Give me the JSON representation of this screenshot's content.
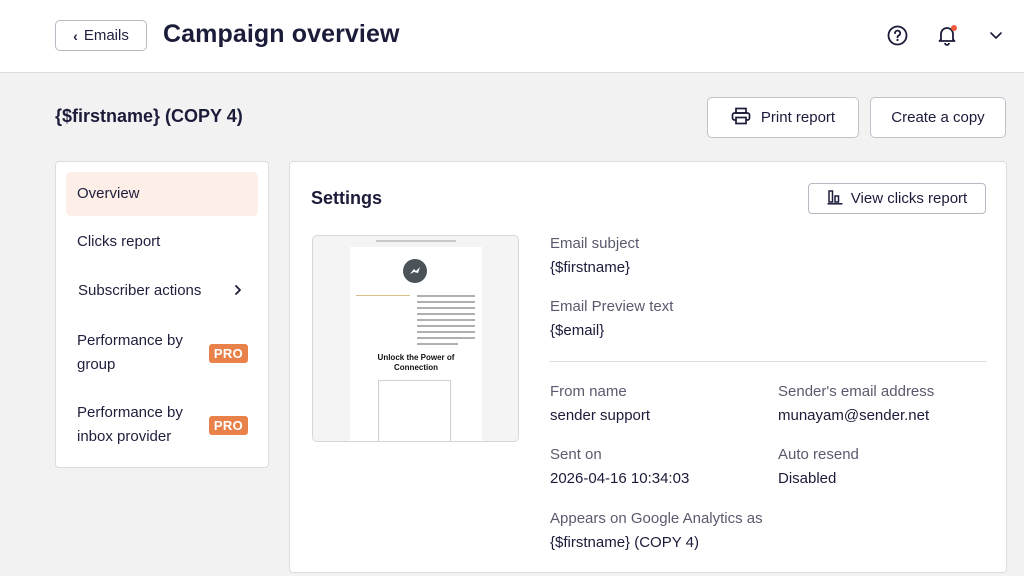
{
  "header": {
    "back_label": "Emails",
    "title": "Campaign overview"
  },
  "campaign": {
    "name": "{$firstname} (COPY 4)",
    "print_label": "Print report",
    "copy_label": "Create a copy"
  },
  "sidebar": {
    "items": [
      {
        "label": "Overview",
        "active": true
      },
      {
        "label": "Clicks report"
      },
      {
        "label": "Subscriber actions"
      },
      {
        "label_line1": "Performance by",
        "label_line2": "group",
        "badge": "PRO"
      },
      {
        "label_line1": "Performance by",
        "label_line2": "inbox provider",
        "badge": "PRO"
      }
    ]
  },
  "settings": {
    "title": "Settings",
    "view_clicks_label": "View clicks report",
    "preview": {
      "heading_line1": "Unlock the Power of",
      "heading_line2": "Connection"
    },
    "fields": {
      "email_subject_label": "Email subject",
      "email_subject_value": "{$firstname}",
      "preview_text_label": "Email Preview text",
      "preview_text_value": "{$email}",
      "from_name_label": "From name",
      "from_name_value": "sender support",
      "sender_email_label": "Sender's email address",
      "sender_email_value": "munayam@sender.net",
      "sent_on_label": "Sent on",
      "sent_on_value": "2026-04-16 10:34:03",
      "auto_resend_label": "Auto resend",
      "auto_resend_value": "Disabled",
      "ga_label": "Appears on Google Analytics as",
      "ga_value": "{$firstname} (COPY 4)"
    }
  },
  "colors": {
    "accent": "#e9824a",
    "active_bg": "#fdefe8",
    "notification_dot": "#f0593e",
    "title_text": "#1b1b3a"
  },
  "icons": [
    "chevron-left-icon",
    "help-icon",
    "bell-icon",
    "chevron-down-icon",
    "printer-icon",
    "chevron-right-icon",
    "bar-chart-icon",
    "logo-icon"
  ]
}
